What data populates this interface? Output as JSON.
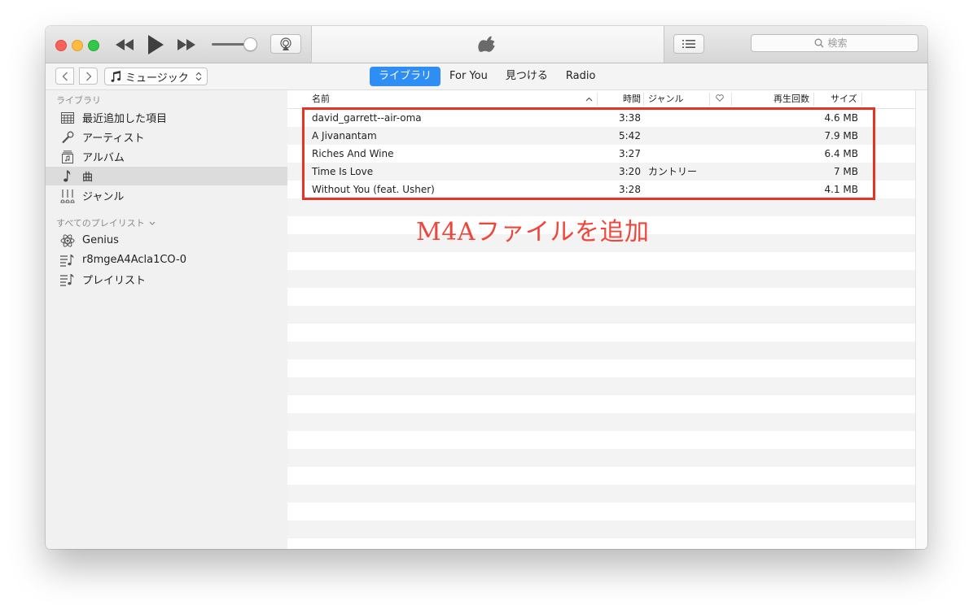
{
  "search": {
    "placeholder": "検索"
  },
  "nav": {
    "media_type": "ミュージック",
    "tabs": [
      {
        "label": "ライブラリ",
        "active": true
      },
      {
        "label": "For You",
        "active": false
      },
      {
        "label": "見つける",
        "active": false
      },
      {
        "label": "Radio",
        "active": false
      }
    ]
  },
  "sidebar": {
    "library_header": "ライブラリ",
    "library_items": [
      {
        "label": "最近追加した項目",
        "icon": "calendar-grid-icon"
      },
      {
        "label": "アーティスト",
        "icon": "microphone-icon"
      },
      {
        "label": "アルバム",
        "icon": "album-icon"
      },
      {
        "label": "曲",
        "icon": "music-note-icon",
        "selected": true
      },
      {
        "label": "ジャンル",
        "icon": "guitar-icon"
      }
    ],
    "playlists_header": "すべてのプレイリスト",
    "playlists": [
      {
        "label": "Genius",
        "icon": "atom-icon"
      },
      {
        "label": "r8mgeA4Acla1CO-0",
        "icon": "playlist-icon"
      },
      {
        "label": "プレイリスト",
        "icon": "playlist-icon"
      }
    ]
  },
  "table": {
    "columns": {
      "name": "名前",
      "time": "時間",
      "genre": "ジャンル",
      "plays": "再生回数",
      "size": "サイズ"
    },
    "rows": [
      {
        "name": "david_garrett--air-oma",
        "time": "3:38",
        "genre": "",
        "size": "4.6 MB"
      },
      {
        "name": "A Jivanantam",
        "time": "5:42",
        "genre": "",
        "size": "7.9 MB"
      },
      {
        "name": "Riches And Wine",
        "time": "3:27",
        "genre": "",
        "size": "6.4 MB"
      },
      {
        "name": "Time Is Love",
        "time": "3:20",
        "genre": "カントリー",
        "size": "7 MB"
      },
      {
        "name": "Without You (feat. Usher)",
        "time": "3:28",
        "genre": "",
        "size": "4.1 MB"
      }
    ]
  },
  "annotation": "M4Aファイルを追加",
  "colors": {
    "accent": "#2e8ef5",
    "annotation": "#f0453a",
    "highlight_border": "#e83222"
  }
}
